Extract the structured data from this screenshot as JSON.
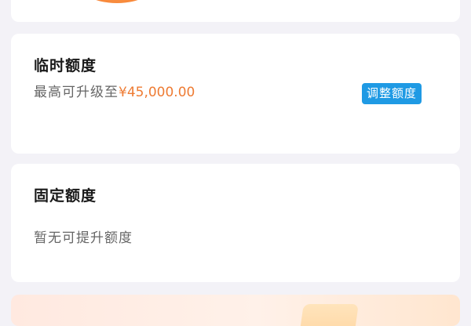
{
  "temporary_limit": {
    "title": "临时额度",
    "description": "最高可升级至",
    "amount": "¥45,000.00",
    "adjust_button": "调整额度"
  },
  "fixed_limit": {
    "title": "固定额度",
    "description": "暂无可提升额度"
  },
  "colors": {
    "accent_orange": "#ee7b33",
    "button_blue": "#1f9ae4",
    "background": "#f3f2f7"
  }
}
